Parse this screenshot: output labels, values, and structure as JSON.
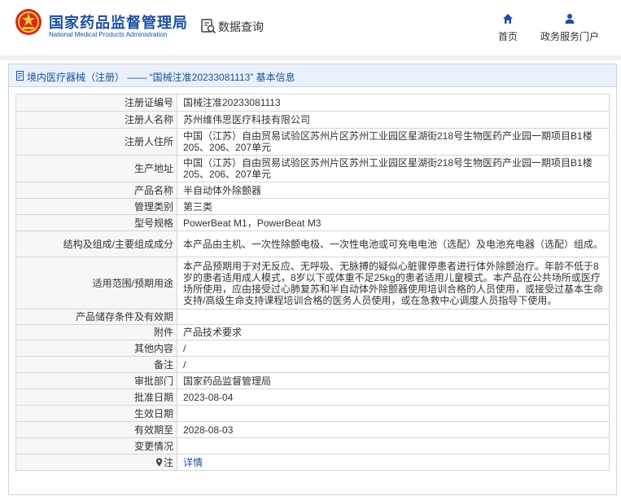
{
  "header": {
    "logo_cn": "国家药品监督管理局",
    "logo_en": "National Medical Products Administration",
    "query_label": "数据查询",
    "nav": [
      {
        "label": "首页",
        "icon": "home-icon"
      },
      {
        "label": "政务服务门户",
        "icon": "user-icon"
      }
    ]
  },
  "panel": {
    "title": "境内医疗器械（注册） —— “国械注准20233081113” 基本信息"
  },
  "record": [
    {
      "key": "注册证编号",
      "value": "国械注准20233081113"
    },
    {
      "key": "注册人名称",
      "value": "苏州维伟思医疗科技有限公司"
    },
    {
      "key": "注册人住所",
      "value": "中国（江苏）自由贸易试验区苏州片区苏州工业园区星湖街218号生物医药产业园一期项目B1楼205、206、207单元"
    },
    {
      "key": "生产地址",
      "value": "中国（江苏）自由贸易试验区苏州片区苏州工业园区星湖街218号生物医药产业园一期项目B1楼205、206、207单元"
    },
    {
      "key": "产品名称",
      "value": "半自动体外除颤器"
    },
    {
      "key": "管理类别",
      "value": "第三类"
    },
    {
      "key": "型号规格",
      "value": "PowerBeat M1，PowerBeat M3"
    },
    {
      "key": "结构及组成/主要组成成分",
      "value": "本产品由主机、一次性除颤电极、一次性电池或可充电电池（选配）及电池充电器（选配）组成。"
    },
    {
      "key": "适用范围/预期用途",
      "value": "本产品预期用于对无反应、无呼吸、无脉搏的疑似心脏骤停患者进行体外除颤治疗。年龄不低于8岁的患者适用成人模式，8岁以下或体重不足25kg的患者适用儿童模式。本产品在公共场所或医疗场所使用，应由接受过心肺复苏和半自动体外除颤器使用培训合格的人员使用，或接受过基本生命支持/高级生命支持课程培训合格的医务人员使用，或在急救中心调度人员指导下使用。"
    },
    {
      "key": "产品储存条件及有效期",
      "value": ""
    },
    {
      "key": "附件",
      "value": "产品技术要求"
    },
    {
      "key": "其他内容",
      "value": "/"
    },
    {
      "key": "备注",
      "value": "/"
    },
    {
      "key": "审批部门",
      "value": "国家药品监督管理局"
    },
    {
      "key": "批准日期",
      "value": "2023-08-04"
    },
    {
      "key": "生效日期",
      "value": ""
    },
    {
      "key": "有效期至",
      "value": "2028-08-03"
    },
    {
      "key": "变更情况",
      "value": ""
    },
    {
      "key": "注",
      "value": "详情"
    }
  ]
}
